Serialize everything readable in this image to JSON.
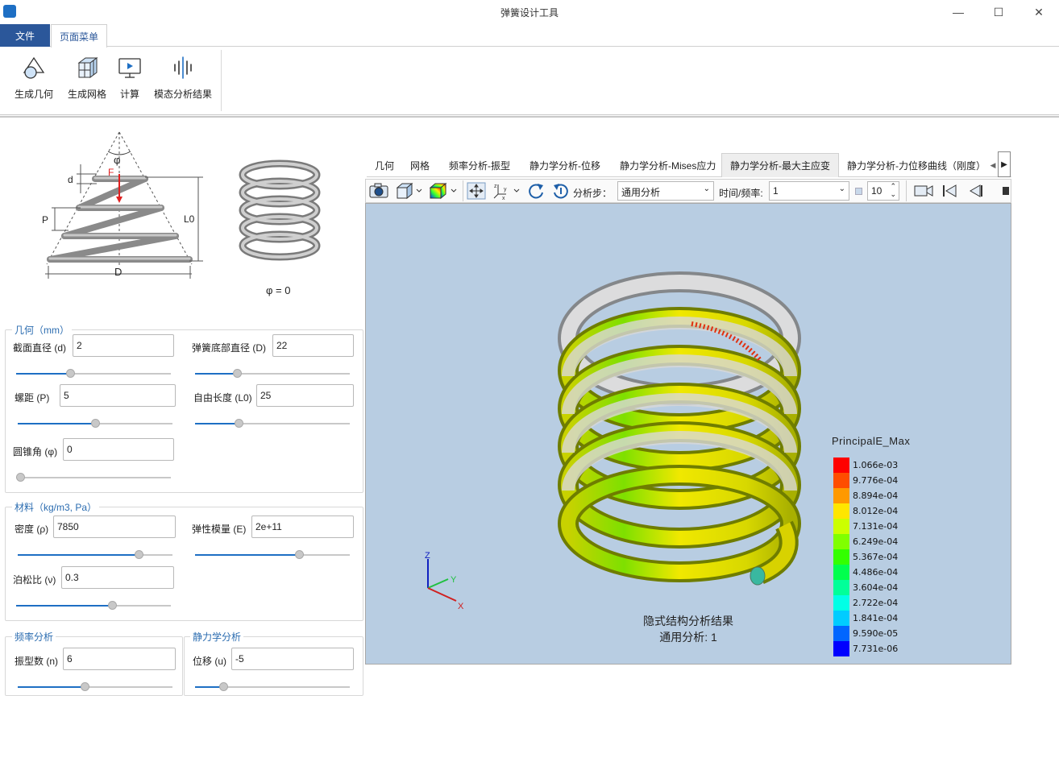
{
  "window": {
    "title": "弹簧设计工具",
    "min": "—",
    "max": "☐",
    "close": "✕"
  },
  "ribbon_tabs": {
    "file": "文件",
    "page_menu": "页面菜单"
  },
  "ribbon": {
    "gen_geometry": "生成几何",
    "gen_mesh": "生成网格",
    "compute": "计算",
    "modal_results": "模态分析结果"
  },
  "diagram": {
    "phi": "φ",
    "d": "d",
    "F": "F",
    "P": "P",
    "L0": "L0",
    "D": "D",
    "caption": "φ = 0"
  },
  "geometry": {
    "title": "几何（mm）",
    "section_dia_label": "截面直径 (d)",
    "section_dia": "2",
    "bottom_dia_label": "弹簧底部直径 (D)",
    "bottom_dia": "22",
    "pitch_label": "螺距 (P)",
    "pitch": "5",
    "free_len_label": "自由长度 (L0)",
    "free_len": "25",
    "cone_label": "圆锥角 (φ)",
    "cone": "0"
  },
  "material": {
    "title": "材料（kg/m3, Pa）",
    "density_label": "密度 (ρ)",
    "density": "7850",
    "modulus_label": "弹性模量 (E)",
    "modulus": "2e+11",
    "poisson_label": "泊松比 (ν)",
    "poisson": "0.3"
  },
  "freq": {
    "title": "频率分析",
    "modes_label": "振型数 (n)",
    "modes": "6"
  },
  "static": {
    "title": "静力学分析",
    "disp_label": "位移 (u)",
    "disp": "-5"
  },
  "sliders": {
    "d": 0.35,
    "D": 0.27,
    "P": 0.5,
    "L0": 0.28,
    "phi": 0.0,
    "rho": 0.78,
    "E": 0.67,
    "nu": 0.62,
    "n": 0.43,
    "u": 0.18
  },
  "viewer_tabs": [
    "几何",
    "网格",
    "频率分析-振型",
    "静力学分析-位移",
    "静力学分析-Mises应力",
    "静力学分析-最大主应变",
    "静力学分析-力位移曲线（刚度）"
  ],
  "active_viewer_tab": 5,
  "toolbar": {
    "step_label": "分析步：",
    "step_value": "通用分析",
    "time_label": "时间/频率:",
    "time_value": "1",
    "frame_value": "10"
  },
  "viewport": {
    "caption_line1": "隐式结构分析结果",
    "caption_line2": "通用分析: 1",
    "axes": {
      "z": "Z",
      "y": "Y",
      "x": "X"
    },
    "legend_title": "PrincipalE_Max",
    "legend": [
      {
        "label": "1.066e-03",
        "color": "#ff0000"
      },
      {
        "label": "9.776e-04",
        "color": "#ff4d00"
      },
      {
        "label": "8.894e-04",
        "color": "#ff9900"
      },
      {
        "label": "8.012e-04",
        "color": "#ffe600"
      },
      {
        "label": "7.131e-04",
        "color": "#ccff00"
      },
      {
        "label": "6.249e-04",
        "color": "#80ff00"
      },
      {
        "label": "5.367e-04",
        "color": "#33ff00"
      },
      {
        "label": "4.486e-04",
        "color": "#00ff4d"
      },
      {
        "label": "3.604e-04",
        "color": "#00ff99"
      },
      {
        "label": "2.722e-04",
        "color": "#00ffe6"
      },
      {
        "label": "1.841e-04",
        "color": "#00ccff"
      },
      {
        "label": "9.590e-05",
        "color": "#0066ff"
      },
      {
        "label": "7.731e-06",
        "color": "#0000ff"
      }
    ]
  }
}
